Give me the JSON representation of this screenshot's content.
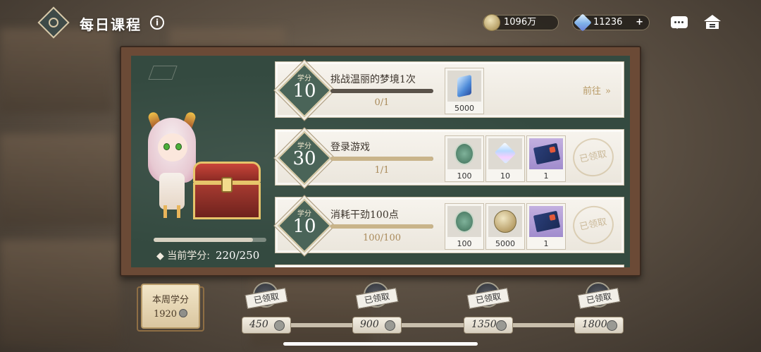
{
  "header": {
    "title": "每日课程",
    "info_label": "i",
    "coin_value": "1096万",
    "gem_value": "11236",
    "gem_plus": "+"
  },
  "character_panel": {
    "score_label": "当前学分:",
    "score_value": "220/250",
    "score_fraction": 0.88
  },
  "quests": [
    {
      "badge_title": "学分",
      "credits": "10",
      "title": "挑战温丽的梦境1次",
      "progress": "0/1",
      "progress_fraction": 0.0,
      "rewards": [
        {
          "icon": "blue-gem-icon",
          "amount": "5000"
        }
      ],
      "action": "前往",
      "action_icon": "chevrons-right-icon"
    },
    {
      "badge_title": "学分",
      "credits": "30",
      "title": "登录游戏",
      "progress": "1/1",
      "progress_fraction": 1.0,
      "rewards": [
        {
          "icon": "green-badge-icon",
          "amount": "100"
        },
        {
          "icon": "crystal-icon",
          "amount": "10"
        },
        {
          "icon": "book-icon",
          "amount": "1"
        }
      ],
      "status": "已领取"
    },
    {
      "badge_title": "学分",
      "credits": "10",
      "title": "消耗干劲100点",
      "progress": "100/100",
      "progress_fraction": 1.0,
      "rewards": [
        {
          "icon": "green-badge-icon",
          "amount": "100"
        },
        {
          "icon": "gold-coin-icon",
          "amount": "5000"
        },
        {
          "icon": "book-icon",
          "amount": "1"
        }
      ],
      "status": "已领取"
    }
  ],
  "weekly": {
    "label": "本周学分",
    "value": "1920",
    "milestones": [
      {
        "value": "450",
        "status": "已领取"
      },
      {
        "value": "900",
        "status": "已领取"
      },
      {
        "value": "1350",
        "status": "已领取"
      },
      {
        "value": "1800",
        "status": "已领取"
      }
    ]
  },
  "colors": {
    "board_green": "#344a40",
    "frame_brown": "#6b4a36",
    "badge_green": "#4a6458",
    "accent_gold": "#c9b48a"
  }
}
